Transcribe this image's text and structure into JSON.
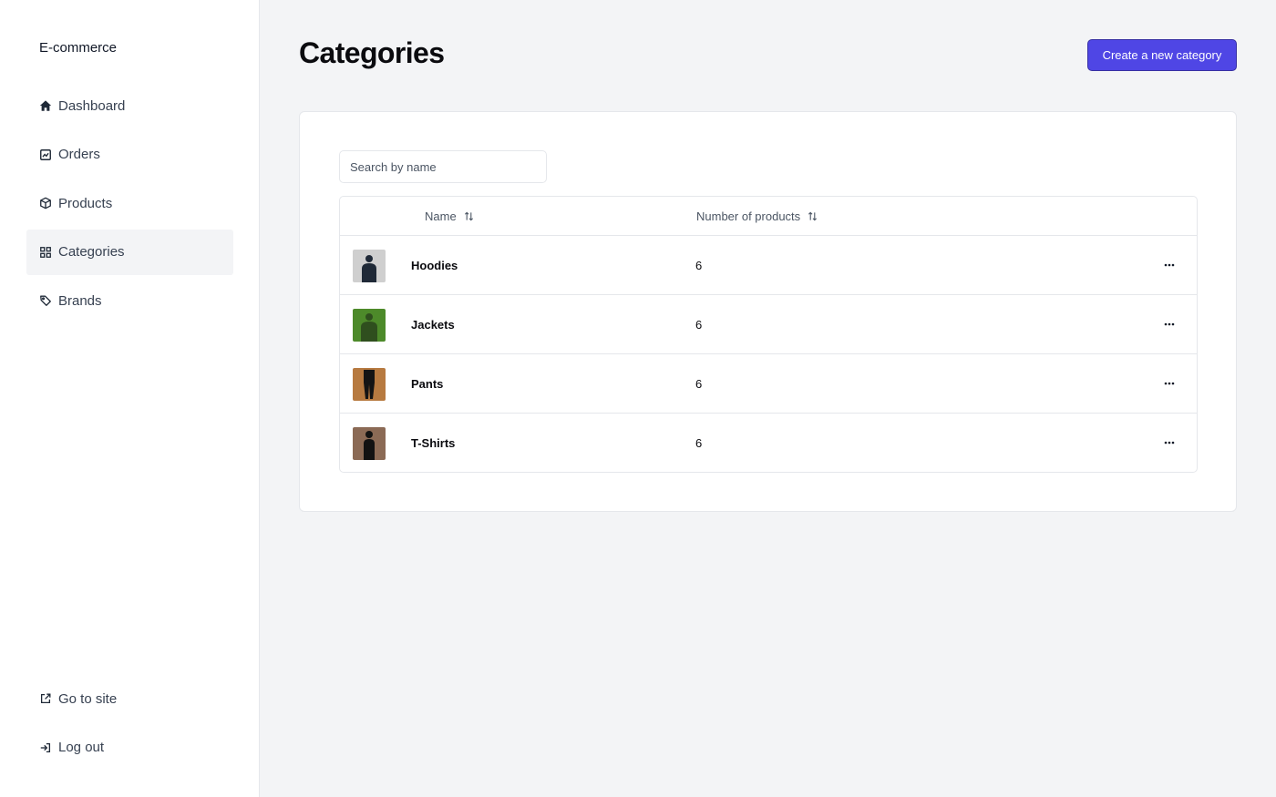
{
  "app": {
    "brand": "E-commerce"
  },
  "sidebar": {
    "items": [
      {
        "label": "Dashboard",
        "icon": "home-icon"
      },
      {
        "label": "Orders",
        "icon": "chart-square-icon"
      },
      {
        "label": "Products",
        "icon": "package-box-icon"
      },
      {
        "label": "Categories",
        "icon": "grid-icon",
        "active": true
      },
      {
        "label": "Brands",
        "icon": "tag-icon"
      }
    ],
    "bottom": [
      {
        "label": "Go to site",
        "icon": "external-link-icon"
      },
      {
        "label": "Log out",
        "icon": "log-out-icon"
      }
    ]
  },
  "header": {
    "title": "Categories",
    "create_label": "Create a new category"
  },
  "search": {
    "placeholder": "Search by name"
  },
  "table": {
    "columns": [
      {
        "label": "Name",
        "sortable": true
      },
      {
        "label": "Number of products",
        "sortable": true
      }
    ],
    "rows": [
      {
        "name": "Hoodies",
        "count": "6",
        "thumb_bg": "#cfcfcf",
        "figure": "#1f2937"
      },
      {
        "name": "Jackets",
        "count": "6",
        "thumb_bg": "#4d8a2a",
        "figure": "#2f4f1e"
      },
      {
        "name": "Pants",
        "count": "6",
        "thumb_bg": "#b77a40",
        "figure": "#141414"
      },
      {
        "name": "T-Shirts",
        "count": "6",
        "thumb_bg": "#8b6a55",
        "figure": "#121212"
      }
    ]
  },
  "colors": {
    "accent": "#4f46e5",
    "background": "#f3f4f6",
    "border": "#e5e7eb"
  }
}
